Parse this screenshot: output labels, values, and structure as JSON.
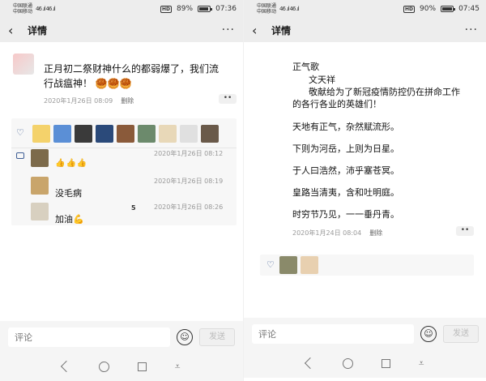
{
  "left": {
    "status": {
      "carrier1": "中国联通",
      "carrier2": "中国移动",
      "signal": "46 .ıl 46 .ıl",
      "hd": "HD",
      "battery": "89%",
      "battery_level": 0.89,
      "time": "07:36"
    },
    "header": {
      "back_icon": "‹",
      "title": "详情",
      "more_icon": "···"
    },
    "post": {
      "text_line1": "正月初二祭财神什么的都弱爆了，我们流",
      "text_line2": "行战瘟神！ 🥮🥮🥮",
      "time": "2020年1月26日 08:09",
      "delete": "删除",
      "more": "••"
    },
    "comments": [
      {
        "time": "2020年1月26日 08:12",
        "text": "👍👍👍"
      },
      {
        "time": "2020年1月26日 08:19",
        "text": "没毛病"
      },
      {
        "time": "2020年1月26日 08:26",
        "text": "加油💪",
        "badge": "5"
      }
    ],
    "input": {
      "placeholder": "评论",
      "send": "发送"
    }
  },
  "right": {
    "status": {
      "carrier1": "中国联通",
      "carrier2": "中国移动",
      "signal": "46 .ıl 46 .ıl",
      "hd": "HD",
      "battery": "90%",
      "battery_level": 0.9,
      "time": "07:45"
    },
    "header": {
      "back_icon": "‹",
      "title": "详情",
      "more_icon": "···"
    },
    "poem": {
      "title": "正气歌",
      "author": "文天祥",
      "dedication1": "敬献给为了新冠疫情防控仍在拼命工作",
      "dedication2": "的各行各业的英雄们！",
      "lines": [
        "天地有正气，杂然赋流形。",
        "下则为河岳，上则为日星。",
        "于人曰浩然，沛乎塞苍冥。",
        "皇路当清夷，含和吐明庭。",
        "时穷节乃见，一一垂丹青。"
      ],
      "time": "2020年1月24日 08:04",
      "delete": "删除",
      "more": "••"
    },
    "input": {
      "placeholder": "评论",
      "send": "发送"
    }
  },
  "colors": {
    "accent": "#3f5e95",
    "bar": "#ededed",
    "likes_bg": "#f7f7f7"
  }
}
